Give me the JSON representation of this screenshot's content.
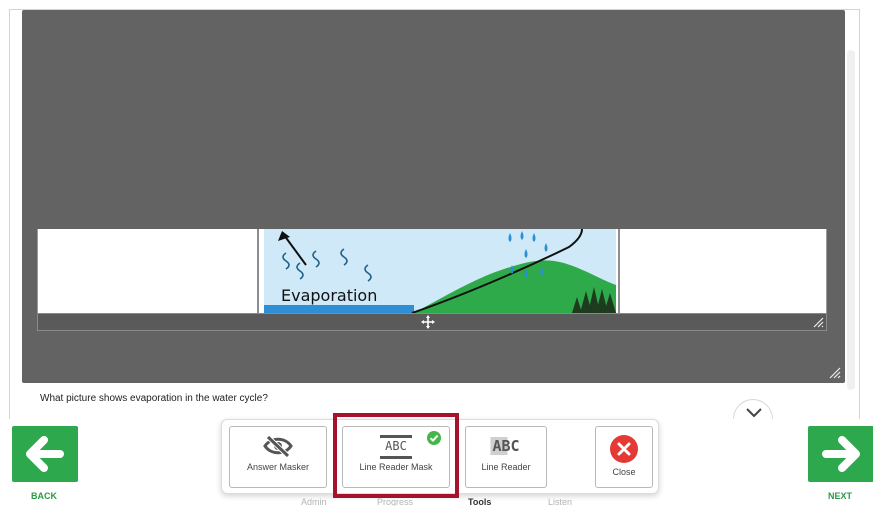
{
  "question": {
    "text": "What picture shows evaporation in the water cycle?"
  },
  "picture": {
    "label": "Evaporation"
  },
  "nav": {
    "back_label": "BACK",
    "next_label": "NEXT"
  },
  "tools": {
    "answer_masker": "Answer Masker",
    "line_reader_mask": "Line Reader Mask",
    "line_reader": "Line Reader",
    "close": "Close",
    "icon_text": "ABC"
  },
  "tabs": [
    "Admin",
    "Progress",
    "Tools",
    "Listen"
  ],
  "active_tab": "Tools",
  "colors": {
    "nav_green": "#2da84c",
    "highlight": "#a6122b",
    "close_red": "#e53935",
    "check_green": "#45b649",
    "mask_gray": "#636363"
  }
}
